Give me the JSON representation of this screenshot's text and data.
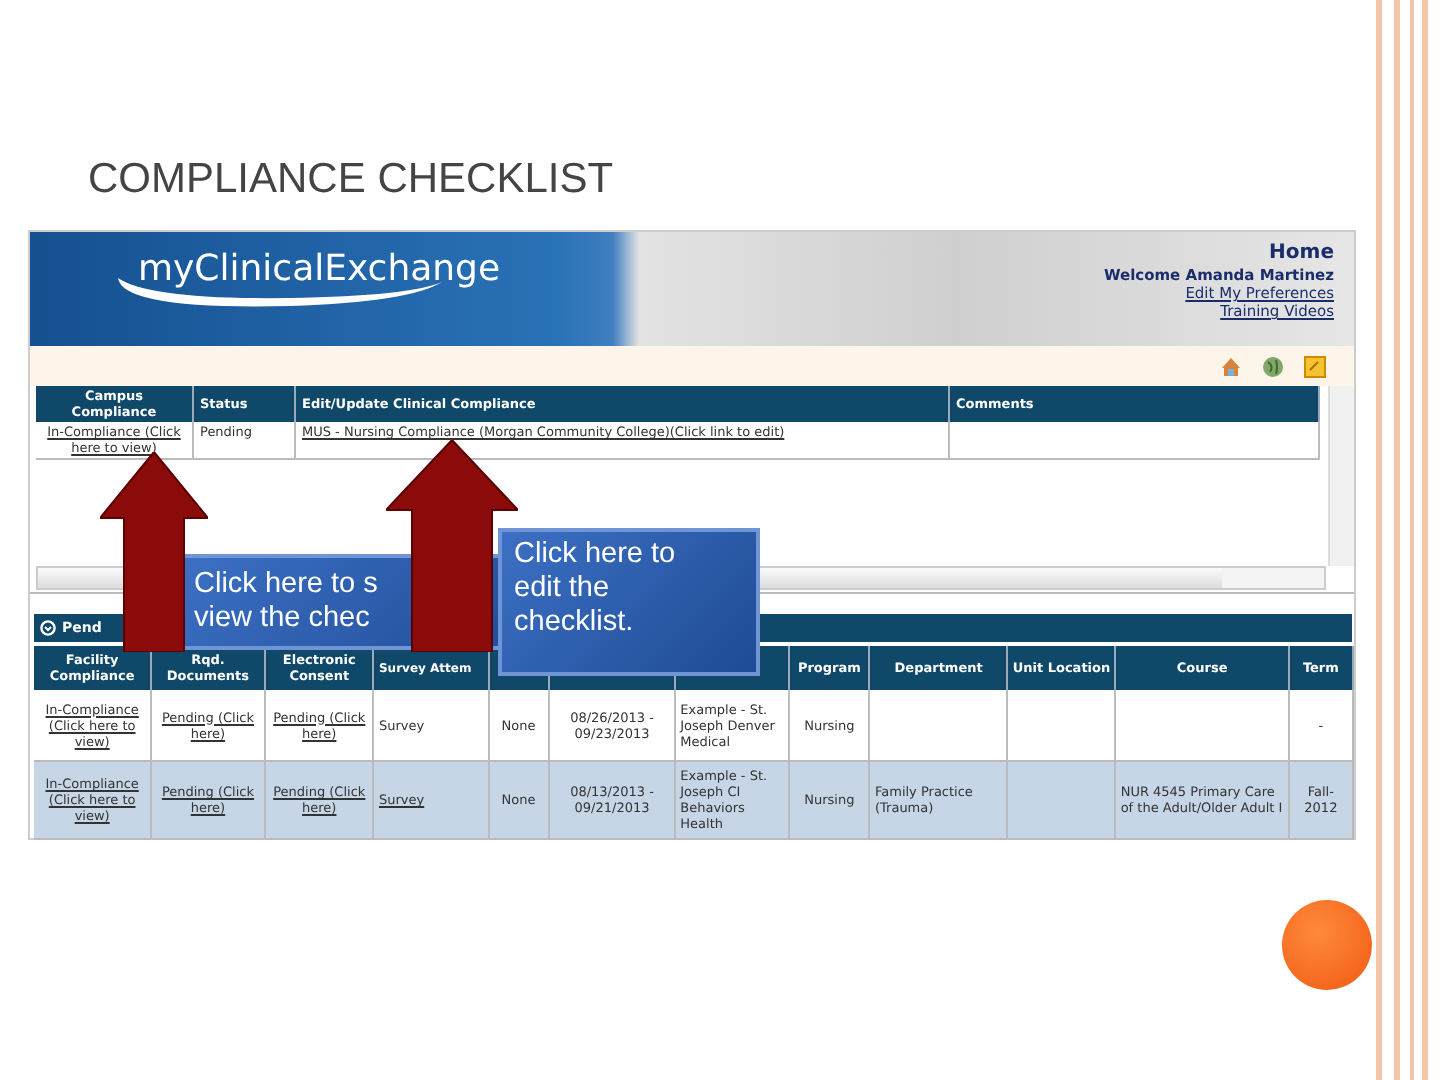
{
  "slide": {
    "title": "COMPLIANCE CHECKLIST"
  },
  "header": {
    "logo": "myClinicalExchange",
    "home": "Home",
    "welcome": "Welcome Amanda Martinez",
    "links": [
      "Edit My Preferences",
      "Training Videos"
    ]
  },
  "campus_table": {
    "columns": [
      "Campus Compliance",
      "Status",
      "Edit/Update Clinical Compliance",
      "Comments"
    ],
    "rows": [
      [
        {
          "text": "In-Compliance (Click here to view)",
          "kind": "link"
        },
        {
          "text": "Pending",
          "kind": "text"
        },
        {
          "text": "MUS - Nursing Compliance (Morgan Community College)(Click link to edit)",
          "kind": "link"
        },
        null
      ]
    ]
  },
  "pending_section": {
    "title": "Pend"
  },
  "placement_table": {
    "columns": [
      "Facility Compliance",
      "Rqd. Documents",
      "Electronic Consent",
      "Survey Attem",
      null,
      null,
      null,
      "Program",
      "Department",
      "Unit Location",
      "Course",
      "Term"
    ],
    "rows": [
      {
        "selected": false,
        "cells": [
          {
            "text": "In-Compliance (Click here to view)",
            "kind": "link"
          },
          {
            "text": "Pending (Click here)",
            "kind": "link"
          },
          {
            "text": "Pending (Click here)",
            "kind": "link"
          },
          {
            "text": "Survey",
            "kind": "text"
          },
          {
            "text": "None",
            "kind": "text"
          },
          {
            "text": "08/26/2013 - 09/23/2013",
            "kind": "text"
          },
          {
            "text": "Example - St. Joseph Denver Medical",
            "kind": "text"
          },
          {
            "text": "Nursing",
            "kind": "text"
          },
          null,
          null,
          null,
          {
            "text": "-",
            "kind": "text"
          }
        ]
      },
      {
        "selected": true,
        "cells": [
          {
            "text": "In-Compliance (Click here to view)",
            "kind": "link"
          },
          {
            "text": "Pending (Click here)",
            "kind": "link"
          },
          {
            "text": "Pending (Click here)",
            "kind": "link"
          },
          {
            "text": "Survey",
            "kind": "link"
          },
          {
            "text": "None",
            "kind": "text"
          },
          {
            "text": "08/13/2013 - 09/21/2013",
            "kind": "text"
          },
          {
            "text": "Example - St. Joseph CI Behaviors Health",
            "kind": "text"
          },
          {
            "text": "Nursing",
            "kind": "text"
          },
          {
            "text": "Family Practice (Trauma)",
            "kind": "text"
          },
          null,
          {
            "text": "NUR 4545 Primary Care of the Adult/Older Adult I",
            "kind": "text"
          },
          {
            "text": "Fall-2012",
            "kind": "text"
          }
        ]
      }
    ]
  },
  "callouts": [
    {
      "lines": [
        "Click here to s",
        "view the chec"
      ]
    },
    {
      "lines": [
        "Click here to",
        "edit the",
        "checklist."
      ]
    }
  ]
}
